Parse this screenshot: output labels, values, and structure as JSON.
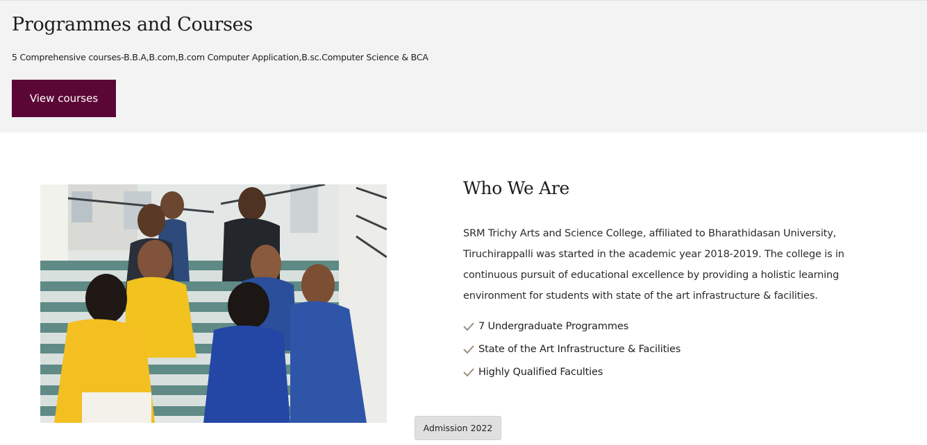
{
  "programmes": {
    "title": "Programmes and Courses",
    "subtitle": "5 Comprehensive courses-B.B.A,B.com,B.com Computer Application,B.sc.Computer Science & BCA",
    "button_label": "View courses"
  },
  "who_we_are": {
    "title": "Who We Are",
    "description": "SRM Trichy Arts and Science College, affiliated to Bharathidasan University, Tiruchirappalli was started in the academic year 2018-2019. The college is in continuous pursuit of educational excellence by providing a holistic learning environment for students with state of the art infrastructure & facilities.",
    "features": [
      "7 Undergraduate Programmes",
      "State of the Art Infrastructure & Facilities",
      "Highly Qualified Faculties"
    ]
  },
  "admission_button": "Admission 2022",
  "colors": {
    "brand": "#5b0735",
    "check": "#9a8f80",
    "section_bg": "#f3f3f3"
  },
  "icons": {
    "feature_check": "check-icon"
  }
}
